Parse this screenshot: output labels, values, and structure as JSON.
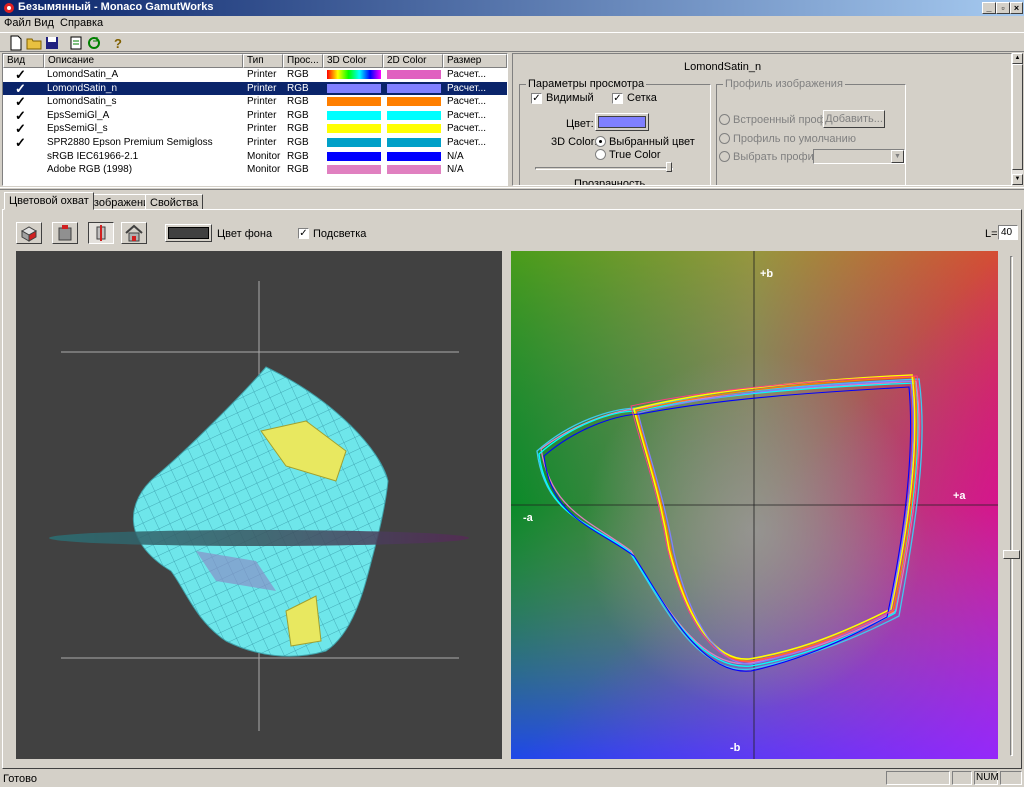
{
  "window": {
    "title": "Безымянный - Monaco GamutWorks"
  },
  "menu": [
    "Файл",
    "Вид",
    "Справка"
  ],
  "list": {
    "headers": [
      "Вид",
      "Описание",
      "Тип",
      "Прос...",
      "3D Color",
      "2D Color",
      "Размер"
    ],
    "rows": [
      {
        "visible": true,
        "name": "LomondSatin_A",
        "type": "Printer",
        "space": "RGB",
        "c3d": "rainbow",
        "c2d": "#e060c0",
        "size": "Расчет..."
      },
      {
        "visible": true,
        "name": "LomondSatin_n",
        "type": "Printer",
        "space": "RGB",
        "c3d": "#8080ff",
        "c2d": "#8080ff",
        "size": "Расчет...",
        "selected": true
      },
      {
        "visible": true,
        "name": "LomondSatin_s",
        "type": "Printer",
        "space": "RGB",
        "c3d": "#ff7f00",
        "c2d": "#ff7f00",
        "size": "Расчет..."
      },
      {
        "visible": true,
        "name": "EpsSemiGl_A",
        "type": "Printer",
        "space": "RGB",
        "c3d": "#00ffff",
        "c2d": "#00ffff",
        "size": "Расчет..."
      },
      {
        "visible": true,
        "name": "EpsSemiGl_s",
        "type": "Printer",
        "space": "RGB",
        "c3d": "#ffff00",
        "c2d": "#ffff00",
        "size": "Расчет..."
      },
      {
        "visible": true,
        "name": "SPR2880 Epson Premium Semigloss",
        "type": "Printer",
        "space": "RGB",
        "c3d": "#00a0c8",
        "c2d": "#00a0c8",
        "size": "Расчет..."
      },
      {
        "visible": false,
        "name": "sRGB IEC61966-2.1",
        "type": "Monitor",
        "space": "RGB",
        "c3d": "#0000ff",
        "c2d": "#0000ff",
        "size": "N/A"
      },
      {
        "visible": false,
        "name": "Adobe RGB (1998)",
        "type": "Monitor",
        "space": "RGB",
        "c3d": "#e080c0",
        "c2d": "#e080c0",
        "size": "N/A"
      }
    ]
  },
  "props": {
    "profile_name": "LomondSatin_n",
    "view_group": "Параметры просмотра",
    "visible_label": "Видимый",
    "visible_checked": true,
    "grid_label": "Сетка",
    "grid_checked": true,
    "color_label": "Цвет:",
    "color_value": "#8080ff",
    "color3d_label": "3D Color:",
    "opt_selected": "Выбранный цвет",
    "opt_true": "True Color",
    "transparency_label": "Прозрачность",
    "image_profile_group": "Профиль изображения",
    "embedded": "Встроенный профиль",
    "add_button": "Добавить...",
    "default_profile": "Профиль по умолчанию",
    "choose_profile": "Выбрать профиль"
  },
  "tabs": [
    "Цветовой охват",
    "Изображение",
    "Свойства"
  ],
  "gamut_toolbar": {
    "bg_label": "Цвет фона",
    "bg_color": "#404040",
    "highlight_label": "Подсветка",
    "highlight_checked": true,
    "l_label": "L=",
    "l_value": "40"
  },
  "plot2d": {
    "plus_b": "+b",
    "minus_b": "-b",
    "plus_a": "+a",
    "minus_a": "-a"
  },
  "status": {
    "text": "Готово",
    "num": "NUM"
  }
}
